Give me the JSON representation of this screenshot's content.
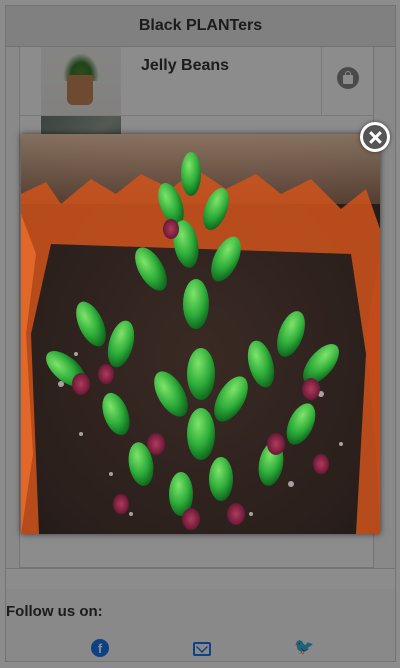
{
  "header": {
    "title": "Black PLANTers"
  },
  "list": {
    "items": [
      {
        "title": "Jelly Beans",
        "image": "potted-succulent-thumbnail",
        "cart_icon": "shopping-bag-icon"
      },
      {
        "title": "",
        "image": "succulent-thumbnail-2"
      }
    ]
  },
  "modal": {
    "image_subject": "jelly-bean-succulent-closeup",
    "close_icon": "close-circle-icon"
  },
  "footer": {
    "follow_label": "Follow us on:",
    "social": [
      {
        "name": "facebook-icon",
        "glyph": "f",
        "color": "#1877f2"
      },
      {
        "name": "email-icon",
        "color": "#1877f2"
      },
      {
        "name": "twitter-icon",
        "glyph": "🐦",
        "color": "#1da1f2"
      }
    ]
  },
  "colors": {
    "overlay": "rgba(0,0,0,0.45)",
    "header_bg": "#e9e9e9",
    "accent": "#1877f2"
  }
}
